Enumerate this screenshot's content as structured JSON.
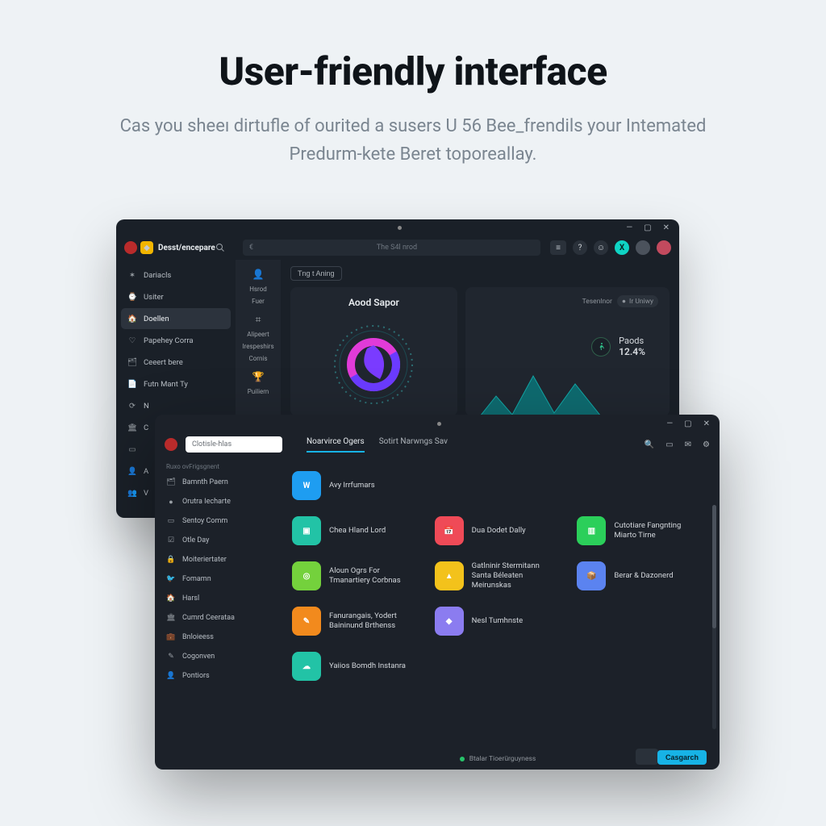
{
  "hero": {
    "title": "User-friendly interface",
    "subtitle": "Cas you sheeı dirtufle of ourited a susers U 56 Bee_frendils your Intemated Predurm-kete Beret toporeallay."
  },
  "windowA": {
    "brand": "Desst/encepare",
    "addressbar": "The S4l nrod",
    "winIcons": {
      "min": "—",
      "max": "▢",
      "close": "✕"
    },
    "topIcons": {
      "menu": "≡",
      "help": "?",
      "user": "☺",
      "avatar": "X",
      "a2": "●",
      "a3": "●"
    },
    "sidebar": [
      {
        "icon": "✶",
        "label": "Dariacls"
      },
      {
        "icon": "⌚",
        "label": "Usiter"
      },
      {
        "icon": "🏠",
        "label": "Doellen",
        "active": true
      },
      {
        "icon": "♡",
        "label": "Papehey Corra"
      },
      {
        "icon": "🗂",
        "label": "Ceeert bere"
      },
      {
        "icon": "📄",
        "label": "Futn Mant Ty"
      },
      {
        "icon": "⟳",
        "label": "N"
      },
      {
        "icon": "🏛",
        "label": "C"
      },
      {
        "icon": "▭",
        "label": ""
      },
      {
        "icon": "👤",
        "label": "A"
      },
      {
        "icon": "👥",
        "label": "V"
      }
    ],
    "rail": [
      {
        "icon": "👤",
        "label": ""
      },
      {
        "icon": "",
        "label": "Hsrod"
      },
      {
        "icon": "",
        "label": "Fuer"
      },
      {
        "icon": "⌗",
        "label": ""
      },
      {
        "icon": "",
        "label": "Alipeert"
      },
      {
        "icon": "",
        "label": "Irespeshirs"
      },
      {
        "icon": "",
        "label": "Cornis"
      },
      {
        "icon": "🏆",
        "label": ""
      },
      {
        "icon": "",
        "label": "Puiliem"
      }
    ],
    "tabButton": "Tng t Aning",
    "gaugeTitle": "Aood Sapor",
    "statLeft": "Tesenlnor",
    "statRight": "Ir Uniwy",
    "legend": {
      "label": "Paods",
      "pct": "12.4%"
    }
  },
  "windowB": {
    "winIcons": {
      "min": "—",
      "max": "▢",
      "close": "✕"
    },
    "searchPlaceholder": "Clotisle-hlas",
    "tabs": [
      {
        "label": "Noarvirce Ogers",
        "active": true
      },
      {
        "label": "Sotirt Narwngs Sav",
        "active": false
      }
    ],
    "rightIcons": [
      "🔍",
      "▭",
      "✉",
      "⚙"
    ],
    "sidebarHeader": "Ruxo ovFrigsgnent",
    "sidebar": [
      {
        "icon": "🗂",
        "label": "Bamnth Paern"
      },
      {
        "icon": "●",
        "label": "Orutra Iecharte"
      },
      {
        "icon": "▭",
        "label": "Sentoy Comm"
      },
      {
        "icon": "☑",
        "label": "Otle Day"
      },
      {
        "icon": "🔒",
        "label": "Moiteriertater"
      },
      {
        "icon": "🐦",
        "label": "Fomamn"
      },
      {
        "icon": "🏠",
        "label": "Harsl"
      },
      {
        "icon": "🏛",
        "label": "Cumrd Ceerataa"
      },
      {
        "icon": "💼",
        "label": "Bnloieess"
      },
      {
        "icon": "✎",
        "label": "Cogonven"
      },
      {
        "icon": "👤",
        "label": "Pontiors"
      }
    ],
    "apps": [
      {
        "color": "#1e9df1",
        "glyph": "W",
        "label": "Avy Irrfumars"
      },
      {
        "color": "",
        "glyph": "",
        "label": ""
      },
      {
        "color": "",
        "glyph": "",
        "label": ""
      },
      {
        "color": "#22c3a6",
        "glyph": "▣",
        "label": "Chea Hland Lord"
      },
      {
        "color": "#ef4a57",
        "glyph": "📅",
        "label": "Dua Dodet Dally"
      },
      {
        "color": "#2bcf5a",
        "glyph": "▥",
        "label": "Cutotiare Fangnting Miarto Tirne"
      },
      {
        "color": "#74d13c",
        "glyph": "◎",
        "label": "Aloun Ogrs For Tmanartiery Corbnas"
      },
      {
        "color": "#f3c21b",
        "glyph": "▲",
        "label": "Gatlninir Stermitann Santa Béleaten Meirunskas"
      },
      {
        "color": "#5b83f0",
        "glyph": "📦",
        "label": "Berar & Dazonerd"
      },
      {
        "color": "#f28a1d",
        "glyph": "✎",
        "label": "Fanurangais, Yodert Baininund Brthenss"
      },
      {
        "color": "#8b7cf0",
        "glyph": "◆",
        "label": "Nesl Tumhnste"
      },
      {
        "color": "",
        "glyph": "",
        "label": ""
      },
      {
        "color": "#22c3a6",
        "glyph": "☁",
        "label": "Yaiios Bomdh Instanra"
      }
    ],
    "footer": "Btalar Tioerürguyness",
    "primary": "Casgarch"
  }
}
